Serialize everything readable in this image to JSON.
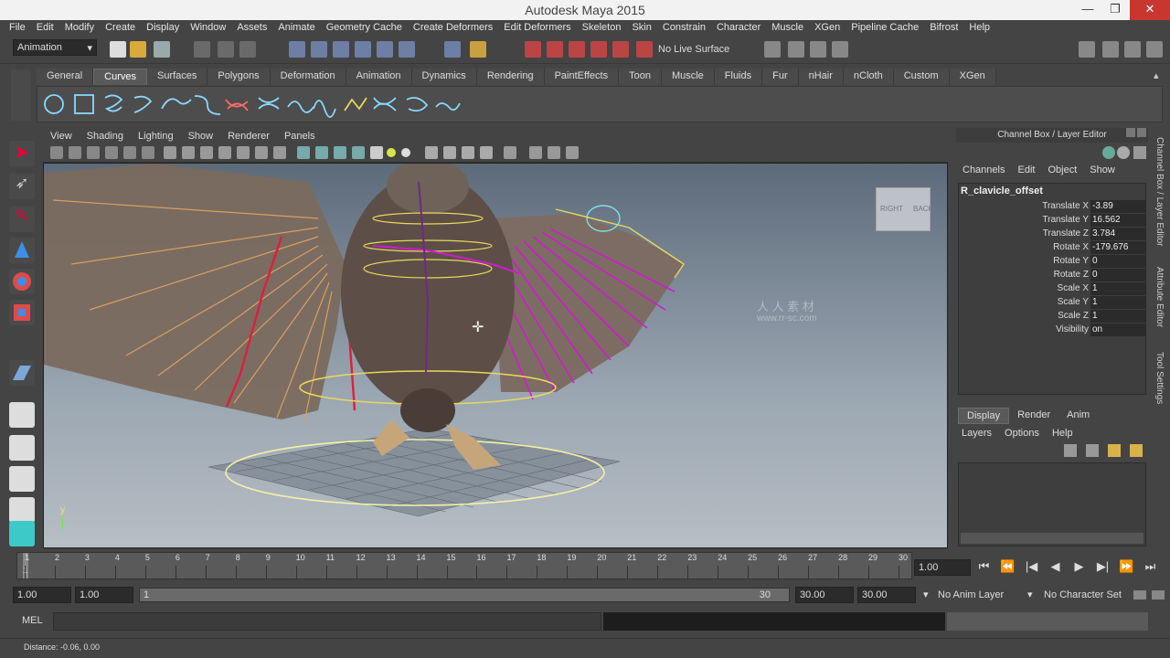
{
  "window": {
    "title": "Autodesk Maya 2015",
    "min": "—",
    "max": "❐",
    "close": "✕"
  },
  "menubar": [
    "File",
    "Edit",
    "Modify",
    "Create",
    "Display",
    "Window",
    "Assets",
    "Animate",
    "Geometry Cache",
    "Create Deformers",
    "Edit Deformers",
    "Skeleton",
    "Skin",
    "Constrain",
    "Character",
    "Muscle",
    "XGen",
    "Pipeline Cache",
    "Bifrost",
    "Help"
  ],
  "status": {
    "mode": "Animation",
    "live_surface": "No Live Surface"
  },
  "shelf_tabs": [
    "General",
    "Curves",
    "Surfaces",
    "Polygons",
    "Deformation",
    "Animation",
    "Dynamics",
    "Rendering",
    "PaintEffects",
    "Toon",
    "Muscle",
    "Fluids",
    "Fur",
    "nHair",
    "nCloth",
    "Custom",
    "XGen"
  ],
  "active_shelf": "Curves",
  "panel_menu": [
    "View",
    "Shading",
    "Lighting",
    "Show",
    "Renderer",
    "Panels"
  ],
  "viewcube": {
    "right": "RIGHT",
    "back": "BACK"
  },
  "axis": {
    "y": "y"
  },
  "watermark": {
    "cn": "人 人 素 材",
    "url": "www.rr-sc.com"
  },
  "channel_box": {
    "header": "Channel Box / Layer Editor",
    "menu": [
      "Channels",
      "Edit",
      "Object",
      "Show"
    ],
    "object": "R_clavicle_offset",
    "attributes": [
      {
        "name": "Translate X",
        "value": "-3.89"
      },
      {
        "name": "Translate Y",
        "value": "16.562"
      },
      {
        "name": "Translate Z",
        "value": "3.784"
      },
      {
        "name": "Rotate X",
        "value": "-179.676"
      },
      {
        "name": "Rotate Y",
        "value": "0"
      },
      {
        "name": "Rotate Z",
        "value": "0"
      },
      {
        "name": "Scale X",
        "value": "1"
      },
      {
        "name": "Scale Y",
        "value": "1"
      },
      {
        "name": "Scale Z",
        "value": "1"
      },
      {
        "name": "Visibility",
        "value": "on"
      }
    ]
  },
  "side_tabs": [
    "Channel Box / Layer Editor",
    "Attribute Editor",
    "Tool Settings"
  ],
  "layer_editor": {
    "tabs": [
      "Display",
      "Render",
      "Anim"
    ],
    "active": "Display",
    "menu": [
      "Layers",
      "Options",
      "Help"
    ]
  },
  "timeline": {
    "ticks": [
      "1",
      "2",
      "3",
      "4",
      "5",
      "6",
      "7",
      "8",
      "9",
      "10",
      "11",
      "12",
      "13",
      "14",
      "15",
      "16",
      "17",
      "18",
      "19",
      "20",
      "21",
      "22",
      "23",
      "24",
      "25",
      "26",
      "27",
      "28",
      "29",
      "30"
    ],
    "current_frame": "1",
    "current_time": "1.00"
  },
  "playback_buttons": [
    "⏮",
    "⏪",
    "|◀",
    "◀",
    "▶",
    "▶|",
    "⏩",
    "⏭"
  ],
  "range": {
    "start_anim": "1.00",
    "start": "1.00",
    "slider_start": "1",
    "slider_end": "30",
    "end": "30.00",
    "end_anim": "30.00",
    "anim_layer": "No Anim Layer",
    "char_set": "No Character Set"
  },
  "cmd": {
    "lang": "MEL"
  },
  "help": "Distance: -0.06, 0.00",
  "colors": {
    "bg": "#444444",
    "wing_brown": "#7a6a5e",
    "rig_magenta": "#d21ad2",
    "rig_red": "#e01e3c",
    "rig_yellow": "#e8d85a",
    "rig_cyan": "#7fe0e6"
  }
}
